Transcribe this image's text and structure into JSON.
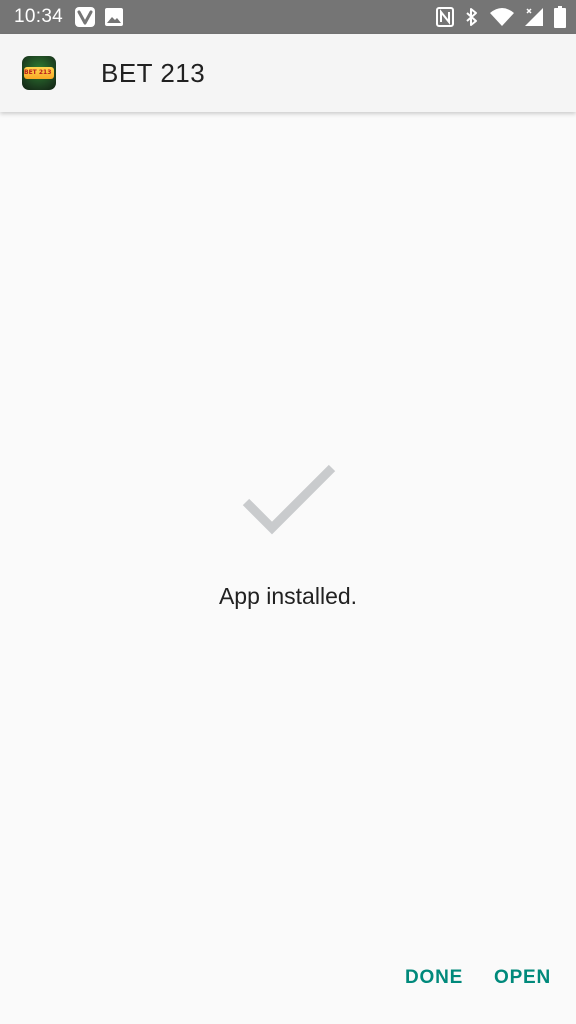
{
  "status_bar": {
    "time": "10:34",
    "left_icons": [
      "vivaldi-icon",
      "image-icon"
    ],
    "right_icons": [
      "nfc-icon",
      "bluetooth-icon",
      "wifi-icon",
      "signal-icon",
      "battery-icon"
    ],
    "background_color": "#757575"
  },
  "app_bar": {
    "app_icon": "bet-213-slots-logo",
    "app_icon_text": "BET 213 SLOTS",
    "title": "BET 213"
  },
  "main": {
    "status_icon": "checkmark-icon",
    "message": "App installed."
  },
  "actions": {
    "done_label": "DONE",
    "open_label": "OPEN",
    "accent_color": "#00897b"
  }
}
